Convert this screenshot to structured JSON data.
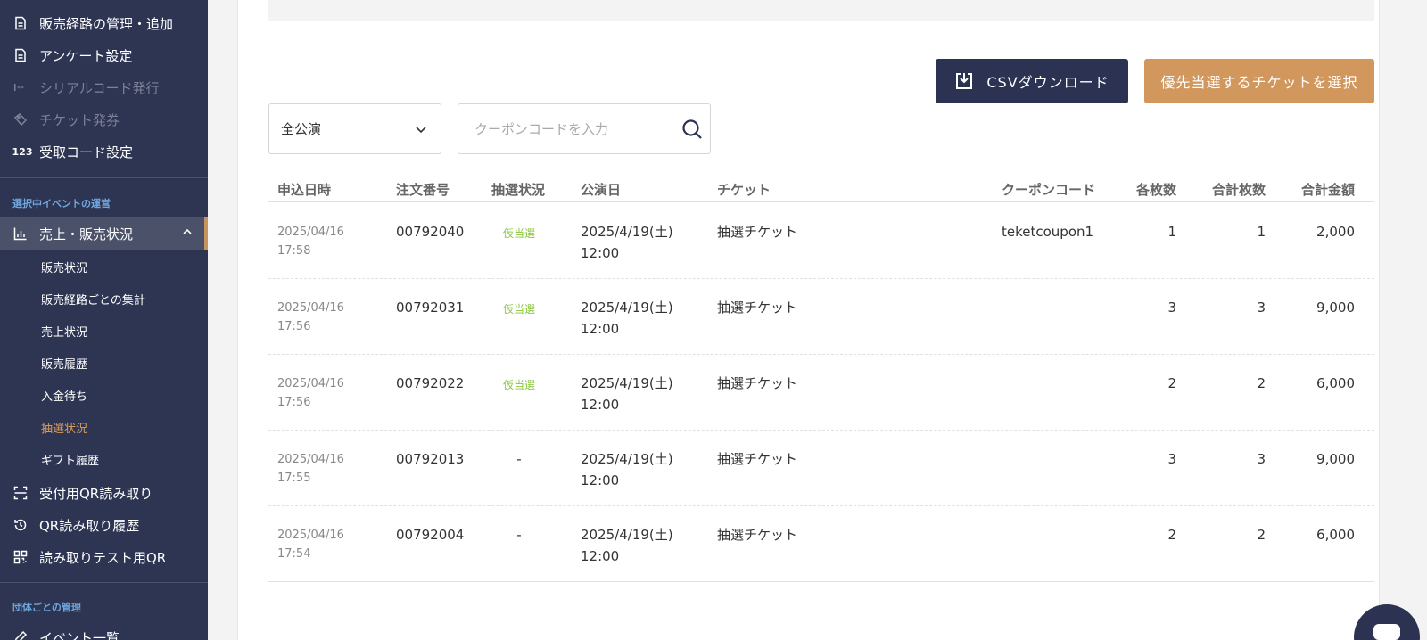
{
  "sidebar": {
    "items_top": [
      {
        "label": "販売経路の管理・追加",
        "icon": "document-icon"
      },
      {
        "label": "アンケート設定",
        "icon": "document-icon"
      },
      {
        "label": "シリアルコード発行",
        "icon": "serial-code-icon"
      },
      {
        "label": "チケット発券",
        "icon": "ticket-icon"
      },
      {
        "label": "受取コード設定",
        "icon": "number-code-icon"
      }
    ],
    "section_event": "選択中イベントの運営",
    "sales_label": "売上・販売状況",
    "sub_items": [
      {
        "label": "販売状況"
      },
      {
        "label": "販売経路ごとの集計"
      },
      {
        "label": "売上状況"
      },
      {
        "label": "販売履歴"
      },
      {
        "label": "入金待ち"
      },
      {
        "label": "抽選状況"
      },
      {
        "label": "ギフト履歴"
      }
    ],
    "items_bottom": [
      {
        "label": "受付用QR読み取り",
        "icon": "qr-scan-icon"
      },
      {
        "label": "QR読み取り履歴",
        "icon": "history-icon"
      },
      {
        "label": "読み取りテスト用QR",
        "icon": "qr-code-icon"
      }
    ],
    "section_org": "団体ごとの管理",
    "event_list": "イベント一覧"
  },
  "toolbar": {
    "csv_label": "CSVダウンロード",
    "priority_label": "優先当選するチケットを選択",
    "filter_value": "全公演",
    "search_placeholder": "クーポンコードを入力"
  },
  "table": {
    "headers": [
      "申込日時",
      "注文番号",
      "抽選状況",
      "公演日",
      "チケット",
      "クーポンコード",
      "各枚数",
      "合計枚数",
      "合計金額"
    ],
    "rows": [
      {
        "date": "2025/04/16",
        "time": "17:58",
        "order": "00792040",
        "status": "仮当選",
        "perf_date": "2025/4/19(土)",
        "perf_time": "12:00",
        "ticket": "抽選チケット",
        "coupon": "teketcoupon1",
        "each": "1",
        "total": "1",
        "amount": "2,000"
      },
      {
        "date": "2025/04/16",
        "time": "17:56",
        "order": "00792031",
        "status": "仮当選",
        "perf_date": "2025/4/19(土)",
        "perf_time": "12:00",
        "ticket": "抽選チケット",
        "coupon": "",
        "each": "3",
        "total": "3",
        "amount": "9,000"
      },
      {
        "date": "2025/04/16",
        "time": "17:56",
        "order": "00792022",
        "status": "仮当選",
        "perf_date": "2025/4/19(土)",
        "perf_time": "12:00",
        "ticket": "抽選チケット",
        "coupon": "",
        "each": "2",
        "total": "2",
        "amount": "6,000"
      },
      {
        "date": "2025/04/16",
        "time": "17:55",
        "order": "00792013",
        "status": "-",
        "perf_date": "2025/4/19(土)",
        "perf_time": "12:00",
        "ticket": "抽選チケット",
        "coupon": "",
        "each": "3",
        "total": "3",
        "amount": "9,000"
      },
      {
        "date": "2025/04/16",
        "time": "17:54",
        "order": "00792004",
        "status": "-",
        "perf_date": "2025/4/19(土)",
        "perf_time": "12:00",
        "ticket": "抽選チケット",
        "coupon": "",
        "each": "2",
        "total": "2",
        "amount": "6,000"
      }
    ]
  },
  "colors": {
    "sidebar_bg": "#2e3553",
    "accent_orange": "#d1975c",
    "navy_button": "#2b3252",
    "status_green": "#8cc63f"
  }
}
